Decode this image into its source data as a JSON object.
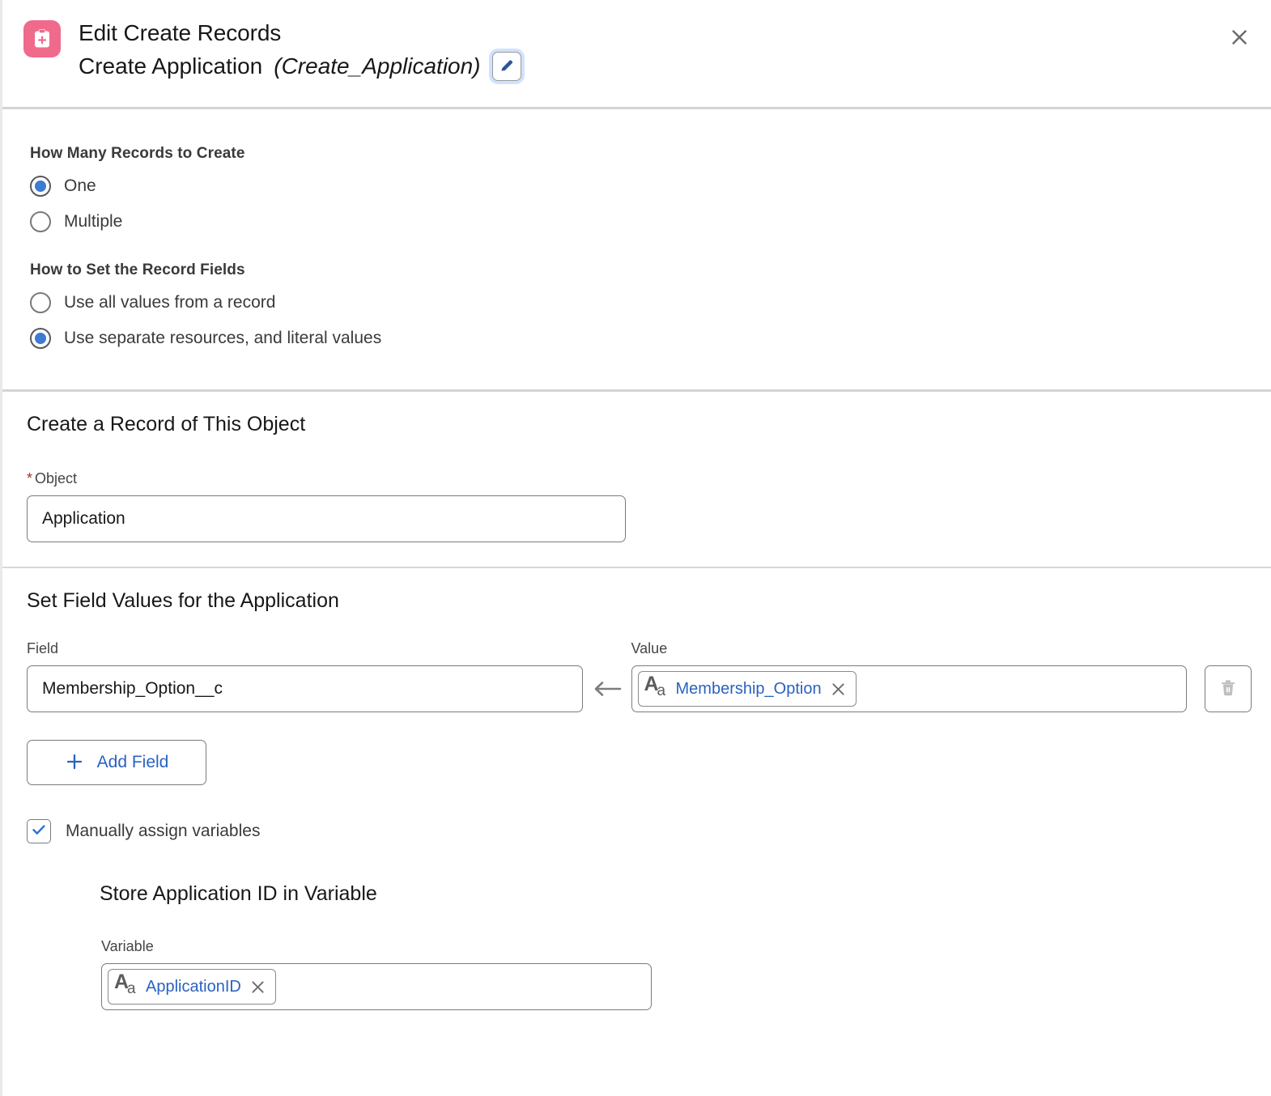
{
  "header": {
    "icon": "create-records-clipboard-plus-icon",
    "title": "Edit Create Records",
    "element_label": "Create Application",
    "api_name": "(Create_Application)",
    "edit_button_icon": "pencil-icon",
    "close_button_icon": "close-icon",
    "accent": "#f06a8c"
  },
  "options": {
    "how_many_label": "How Many Records to Create",
    "how_many_choices": [
      {
        "label": "One",
        "selected": true
      },
      {
        "label": "Multiple",
        "selected": false
      }
    ],
    "how_to_set_label": "How to Set the Record Fields",
    "how_to_set_choices": [
      {
        "label": "Use all values from a record",
        "selected": false
      },
      {
        "label": "Use separate resources, and literal values",
        "selected": true
      }
    ]
  },
  "object_section": {
    "heading": "Create a Record of This Object",
    "field_label": "Object",
    "required_marker": "*",
    "value": "Application"
  },
  "field_values_section": {
    "heading": "Set Field Values for the Application",
    "field_column_label": "Field",
    "value_column_label": "Value",
    "arrow_icon": "arrow-left-icon",
    "rows": [
      {
        "field": "Membership_Option__c",
        "value_pill": {
          "icon": "text-resource-aa-icon",
          "text": "Membership_Option",
          "remove_icon": "close-icon"
        },
        "delete_icon": "trash-icon",
        "delete_disabled": true
      }
    ],
    "add_field_button": {
      "icon": "plus-icon",
      "label": "Add Field"
    },
    "manually_assign_checkbox": {
      "label": "Manually assign variables",
      "checked": true,
      "check_icon": "check-icon"
    }
  },
  "store_variable_section": {
    "heading": "Store Application ID in Variable",
    "field_label": "Variable",
    "value_pill": {
      "icon": "text-resource-aa-icon",
      "text": "ApplicationID",
      "remove_icon": "close-icon"
    }
  },
  "colors": {
    "link_blue": "#2a62c0",
    "radio_blue": "#3c7cd1",
    "required_red": "#a4322a",
    "icon_pink": "#f06a8c",
    "text_dark": "#181818",
    "divider": "#d4d4d6"
  }
}
